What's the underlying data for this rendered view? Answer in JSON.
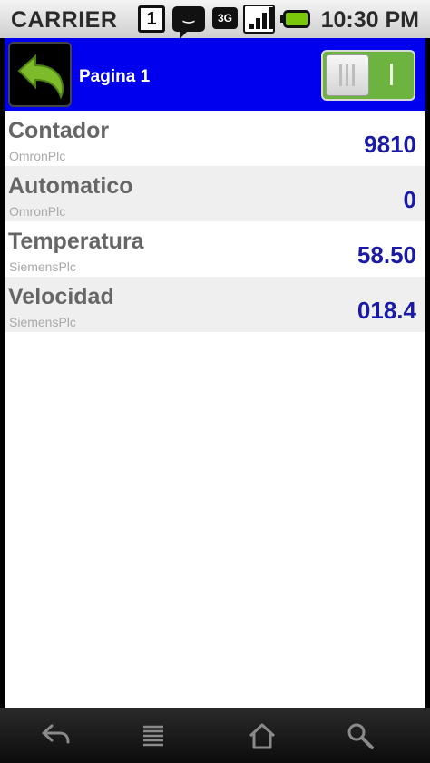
{
  "status_bar": {
    "carrier": "CARRIER",
    "calendar_day": "1",
    "network_type": "3G",
    "time": "10:30 PM",
    "icons": [
      "calendar-icon",
      "chat-icon",
      "3g-icon",
      "signal-icon",
      "battery-icon"
    ]
  },
  "header": {
    "title": "Pagina 1",
    "back_icon": "undo-arrow-icon",
    "toggle_state": "on",
    "background_color": "#0000ee"
  },
  "rows": [
    {
      "name": "Contador",
      "source": "OmronPlc",
      "value": "9810"
    },
    {
      "name": "Automatico",
      "source": "OmronPlc",
      "value": "0"
    },
    {
      "name": "Temperatura",
      "source": "SiemensPlc",
      "value": "58.50"
    },
    {
      "name": "Velocidad",
      "source": "SiemensPlc",
      "value": "018.4"
    }
  ],
  "nav_bar": {
    "icons": [
      "back-icon",
      "menu-icon",
      "home-icon",
      "search-icon"
    ]
  },
  "colors": {
    "value_text": "#1a1aa6",
    "toggle_on": "#6db33f"
  }
}
